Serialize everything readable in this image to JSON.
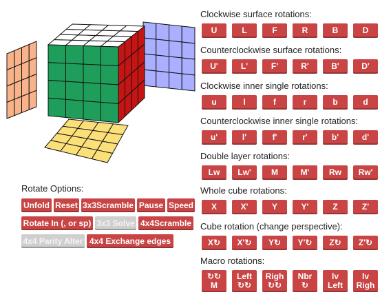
{
  "sections": [
    {
      "title": "Clockwise surface rotations",
      "buttons": [
        "U",
        "L",
        "F",
        "R",
        "B",
        "D"
      ]
    },
    {
      "title": "Counterclockwise surface rotations",
      "buttons": [
        "U'",
        "L'",
        "F'",
        "R'",
        "B'",
        "D'"
      ]
    },
    {
      "title": "Clockwise inner single rotations",
      "buttons": [
        "u",
        "l",
        "f",
        "r",
        "b",
        "d"
      ]
    },
    {
      "title": "Counterclockwise inner single rotations",
      "buttons": [
        "u'",
        "l'",
        "f'",
        "r'",
        "b'",
        "d'"
      ]
    },
    {
      "title": "Double layer rotations",
      "buttons": [
        "Lw",
        "Lw'",
        "M",
        "M'",
        "Rw",
        "Rw'"
      ]
    },
    {
      "title": "Whole cube rotations",
      "buttons": [
        "X",
        "X'",
        "Y",
        "Y'",
        "Z",
        "Z'"
      ]
    },
    {
      "title": "Cube rotation (change perspective)",
      "buttons": [
        "X↻",
        "X'↻",
        "Y↻",
        "Y'↻",
        "Z↻",
        "Z'↻"
      ]
    },
    {
      "title": "Macro rotations",
      "buttons": [
        "↻↻\nM",
        "Left\n↻↻",
        "Righ\n↻↻",
        "Nbr\n↻",
        "lv\nLeft",
        "lv\nRigh"
      ]
    }
  ],
  "rotate_options": {
    "title": "Rotate Options:",
    "row1": [
      "Unfold",
      "Reset",
      "3x3Scramble",
      "Pause",
      "Speed"
    ],
    "row2": [
      "Rotate In (, or sp)",
      "3x3 Solve",
      "4x4Scramble"
    ],
    "row3": [
      "4x4 Parity Alter",
      "4x4 Exchange edges"
    ],
    "disabled": [
      "3x3 Solve",
      "4x4 Parity Alter"
    ]
  },
  "colors": {
    "button": "#c94444",
    "button_disabled": "#cfcfcf",
    "cube_top": "#ffffff",
    "cube_front": "#1e9e5a",
    "cube_right": "#c51414",
    "cube_bottom": "#fbe07a",
    "cube_left": "#f9b38a",
    "cube_back": "#aab0ff"
  }
}
